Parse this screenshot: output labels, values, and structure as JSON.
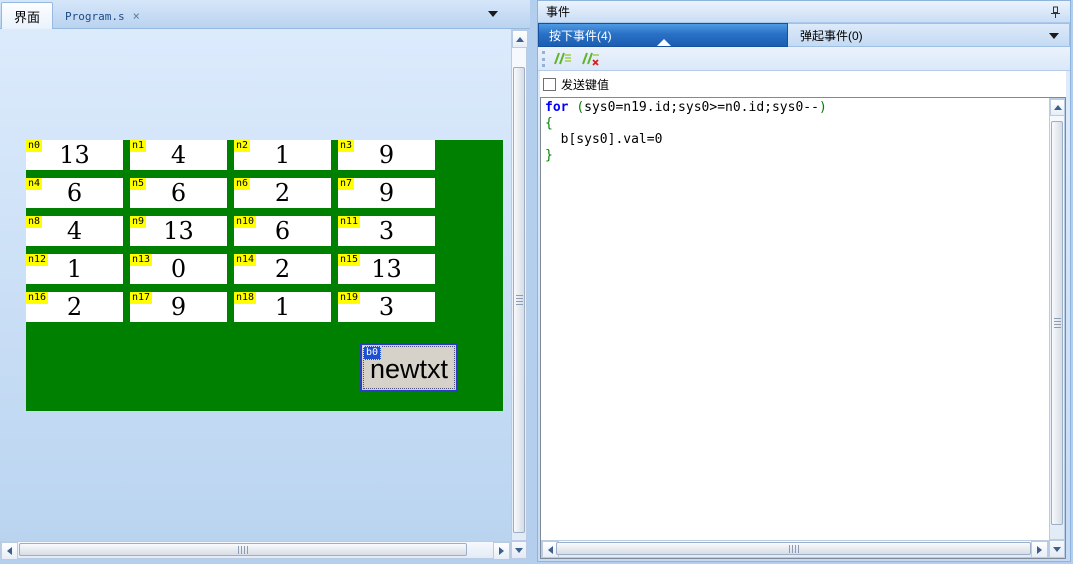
{
  "left_panel": {
    "tabs": [
      {
        "label": "界面",
        "active": true
      },
      {
        "label": "Program.s",
        "active": false
      }
    ],
    "tab_close": "×",
    "designer": {
      "panel_color": "#008000",
      "label_color": "#ffff00",
      "cells": [
        {
          "label": "n0",
          "value": "13"
        },
        {
          "label": "n1",
          "value": "4"
        },
        {
          "label": "n2",
          "value": "1"
        },
        {
          "label": "n3",
          "value": "9"
        },
        {
          "label": "n4",
          "value": "6"
        },
        {
          "label": "n5",
          "value": "6"
        },
        {
          "label": "n6",
          "value": "2"
        },
        {
          "label": "n7",
          "value": "9"
        },
        {
          "label": "n8",
          "value": "4"
        },
        {
          "label": "n9",
          "value": "13"
        },
        {
          "label": "n10",
          "value": "6"
        },
        {
          "label": "n11",
          "value": "3"
        },
        {
          "label": "n12",
          "value": "1"
        },
        {
          "label": "n13",
          "value": "0"
        },
        {
          "label": "n14",
          "value": "2"
        },
        {
          "label": "n15",
          "value": "13"
        },
        {
          "label": "n16",
          "value": "2"
        },
        {
          "label": "n17",
          "value": "9"
        },
        {
          "label": "n18",
          "value": "1"
        },
        {
          "label": "n19",
          "value": "3"
        }
      ],
      "textbox": {
        "label": "b0",
        "text": "newtxt"
      }
    }
  },
  "right_panel": {
    "title": "事件",
    "event_tabs": [
      {
        "label": "按下事件(4)",
        "active": true
      },
      {
        "label": "弹起事件(0)",
        "active": false
      }
    ],
    "checkbox": {
      "label": "发送键值",
      "checked": false
    },
    "code_lines": [
      [
        {
          "t": "for",
          "c": "kw"
        },
        {
          "t": " ",
          "c": "pl"
        },
        {
          "t": "(",
          "c": "br"
        },
        {
          "t": "sys0=n19.id;sys0>=n0.id;sys0--",
          "c": "pl"
        },
        {
          "t": ")",
          "c": "br"
        }
      ],
      [
        {
          "t": "{",
          "c": "br"
        }
      ],
      [
        {
          "t": "  b[sys0].val=0",
          "c": "pl"
        }
      ],
      [
        {
          "t": "}",
          "c": "br"
        }
      ]
    ],
    "syntax_colors": {
      "keyword": "#0000ff",
      "bracket": "#008000",
      "plain": "#000000"
    }
  }
}
